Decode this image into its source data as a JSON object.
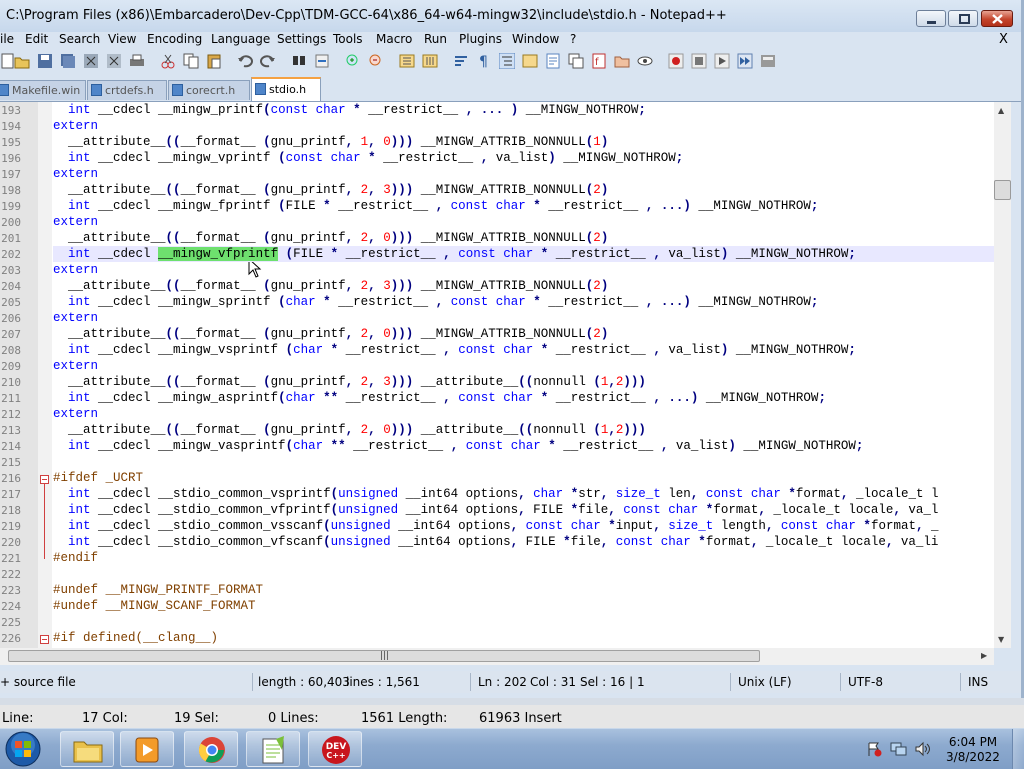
{
  "window": {
    "title": "C:\\Program Files (x86)\\Embarcadero\\Dev-Cpp\\TDM-GCC-64\\x86_64-w64-mingw32\\include\\stdio.h - Notepad++"
  },
  "menu": {
    "items": [
      "ile",
      "Edit",
      "Search",
      "View",
      "Encoding",
      "Language",
      "Settings",
      "Tools",
      "Macro",
      "Run",
      "Plugins",
      "Window",
      "?"
    ],
    "close_x": "X"
  },
  "tabs": [
    {
      "label": "Makefile.win",
      "active": false
    },
    {
      "label": "crtdefs.h",
      "active": false
    },
    {
      "label": "corecrt.h",
      "active": false
    },
    {
      "label": "stdio.h",
      "active": true
    }
  ],
  "editor": {
    "line_numbers": [
      "193",
      "194",
      "195",
      "196",
      "197",
      "198",
      "199",
      "200",
      "201",
      "202",
      "203",
      "204",
      "205",
      "206",
      "207",
      "208",
      "209",
      "210",
      "211",
      "212",
      "213",
      "214",
      "215",
      "216",
      "217",
      "218",
      "219",
      "220",
      "221",
      "222",
      "223",
      "224",
      "225",
      "226"
    ],
    "current_line": "202",
    "selected_text": "__mingw_vfprintf",
    "lines_text": [
      "  int __cdecl __mingw_printf(const char * __restrict__ , ... ) __MINGW_NOTHROW;",
      "extern",
      "  __attribute__((__format__ (gnu_printf, 1, 0))) __MINGW_ATTRIB_NONNULL(1)",
      "  int __cdecl __mingw_vprintf (const char * __restrict__ , va_list) __MINGW_NOTHROW;",
      "extern",
      "  __attribute__((__format__ (gnu_printf, 2, 3))) __MINGW_ATTRIB_NONNULL(2)",
      "  int __cdecl __mingw_fprintf (FILE * __restrict__ , const char * __restrict__ , ...) __MINGW_NOTHROW;",
      "extern",
      "  __attribute__((__format__ (gnu_printf, 2, 0))) __MINGW_ATTRIB_NONNULL(2)",
      "  int __cdecl __mingw_vfprintf (FILE * __restrict__ , const char * __restrict__ , va_list) __MINGW_NOTHROW;",
      "extern",
      "  __attribute__((__format__ (gnu_printf, 2, 3))) __MINGW_ATTRIB_NONNULL(2)",
      "  int __cdecl __mingw_sprintf (char * __restrict__ , const char * __restrict__ , ...) __MINGW_NOTHROW;",
      "extern",
      "  __attribute__((__format__ (gnu_printf, 2, 0))) __MINGW_ATTRIB_NONNULL(2)",
      "  int __cdecl __mingw_vsprintf (char * __restrict__ , const char * __restrict__ , va_list) __MINGW_NOTHROW;",
      "extern",
      "  __attribute__((__format__ (gnu_printf, 2, 3))) __attribute__((nonnull (1,2)))",
      "  int __cdecl __mingw_asprintf(char ** __restrict__ , const char * __restrict__ , ...) __MINGW_NOTHROW;",
      "extern",
      "  __attribute__((__format__ (gnu_printf, 2, 0))) __attribute__((nonnull (1,2)))",
      "  int __cdecl __mingw_vasprintf(char ** __restrict__ , const char * __restrict__ , va_list) __MINGW_NOTHROW;",
      "",
      "#ifdef _UCRT",
      "  int __cdecl __stdio_common_vsprintf(unsigned __int64 options, char *str, size_t len, const char *format, _locale_t l",
      "  int __cdecl __stdio_common_vfprintf(unsigned __int64 options, FILE *file, const char *format, _locale_t locale, va_l",
      "  int __cdecl __stdio_common_vsscanf(unsigned __int64 options, const char *input, size_t length, const char *format, _",
      "  int __cdecl __stdio_common_vfscanf(unsigned __int64 options, FILE *file, const char *format, _locale_t locale, va_li",
      "#endif",
      "",
      "#undef __MINGW_PRINTF_FORMAT",
      "#undef __MINGW_SCANF_FORMAT",
      "",
      "#if defined(__clang__)"
    ]
  },
  "statusbar": {
    "file_type": "+ source file",
    "length": "length : 60,403",
    "lines": "lines : 1,561",
    "ln": "Ln : 202",
    "col": "Col : 31",
    "sel": "Sel : 16 | 1",
    "eol": "Unix (LF)",
    "encoding": "UTF-8",
    "mode": "INS"
  },
  "background_app_status": {
    "line": "Line:",
    "col": "17 Col:",
    "sel": "19 Sel:",
    "lines": "0 Lines:",
    "length": "1561 Length:",
    "insert": "61963 Insert"
  },
  "taskbar": {
    "time": "6:04 PM",
    "date": "3/8/2022",
    "apps": [
      "windows-explorer",
      "media-player",
      "chrome",
      "notepad-plus-plus",
      "dev-cpp"
    ],
    "devcpp_label_top": "DEV",
    "devcpp_label_bottom": "C++"
  },
  "colors": {
    "keyword": "#0000ff",
    "type": "#8000ff",
    "preprocessor": "#804000",
    "number": "#ff0000",
    "selection": "#6ee06e",
    "current_line": "#e8e8ff"
  }
}
